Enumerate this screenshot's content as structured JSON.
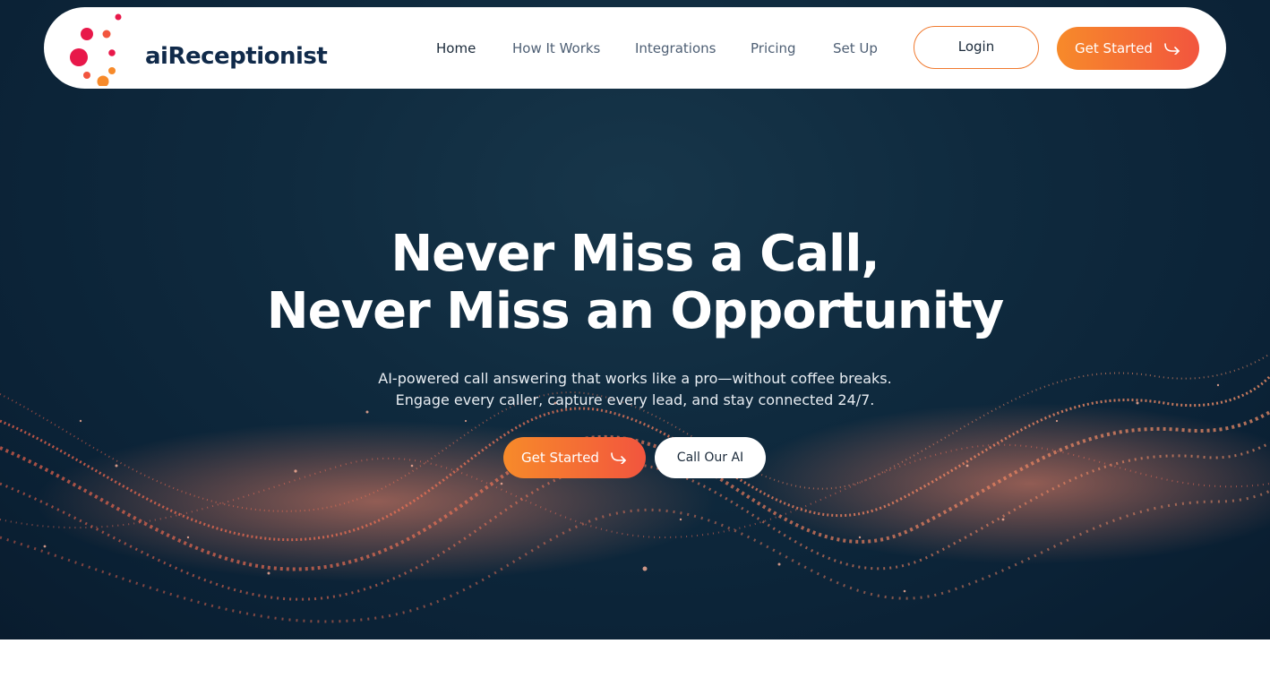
{
  "brand": {
    "name": "aiReceptionist",
    "colors": {
      "navy": "#102a4a",
      "orange": "#f78a2a",
      "coral": "#f2553e",
      "magenta": "#e8184a"
    }
  },
  "nav": {
    "links": [
      {
        "label": "Home",
        "active": true
      },
      {
        "label": "How It Works",
        "active": false
      },
      {
        "label": "Integrations",
        "active": false
      },
      {
        "label": "Pricing",
        "active": false
      },
      {
        "label": "Set Up",
        "active": false
      }
    ],
    "login_label": "Login",
    "get_started_label": "Get Started",
    "get_started_icon": "arrow-curve-right-icon"
  },
  "hero": {
    "title_line1": "Never Miss a Call,",
    "title_line2": "Never Miss an Opportunity",
    "subtitle_line1": "AI-powered call answering that works like a pro—without coffee breaks.",
    "subtitle_line2": "Engage every caller, capture every lead, and stay connected 24/7.",
    "primary_cta": "Get Started",
    "secondary_cta": "Call Our AI"
  }
}
